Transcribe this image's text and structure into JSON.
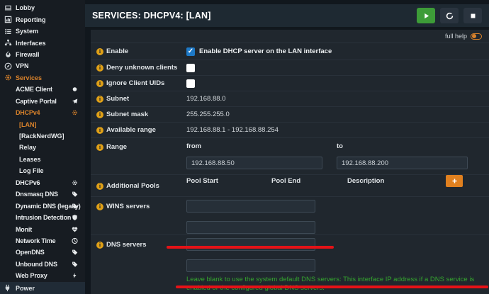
{
  "colors": {
    "accent_orange": "#d9822b",
    "note_green": "#35a62e",
    "annotation_red": "#e51217",
    "checkbox_blue": "#1d79c7",
    "play_green": "#3d9c38"
  },
  "sidebar": {
    "items": [
      {
        "label": "Lobby",
        "level": 0,
        "icon": "lobby-icon"
      },
      {
        "label": "Reporting",
        "level": 0,
        "icon": "reporting-icon"
      },
      {
        "label": "System",
        "level": 0,
        "icon": "system-icon"
      },
      {
        "label": "Interfaces",
        "level": 0,
        "icon": "interfaces-icon"
      },
      {
        "label": "Firewall",
        "level": 0,
        "icon": "firewall-icon"
      },
      {
        "label": "VPN",
        "level": 0,
        "icon": "vpn-icon"
      },
      {
        "label": "Services",
        "level": 0,
        "icon": "gear-icon",
        "active": true
      },
      {
        "label": "ACME Client",
        "level": 1,
        "right_icon": "circle-icon"
      },
      {
        "label": "Captive Portal",
        "level": 1,
        "right_icon": "paper-plane-icon"
      },
      {
        "label": "DHCPv4",
        "level": 1,
        "right_icon": "gear-icon",
        "active": true
      },
      {
        "label": "[LAN]",
        "level": 2,
        "active": true
      },
      {
        "label": "[RackNerdWG]",
        "level": 2
      },
      {
        "label": "Relay",
        "level": 2
      },
      {
        "label": "Leases",
        "level": 2
      },
      {
        "label": "Log File",
        "level": 2
      },
      {
        "label": "DHCPv6",
        "level": 1,
        "right_icon": "gear-icon"
      },
      {
        "label": "Dnsmasq DNS",
        "level": 1,
        "right_icon": "tag-icon"
      },
      {
        "label": "Dynamic DNS (legacy)",
        "level": 1,
        "right_icon": "tag-icon"
      },
      {
        "label": "Intrusion Detection",
        "level": 1,
        "right_icon": "shield-icon"
      },
      {
        "label": "Monit",
        "level": 1,
        "right_icon": "heartbeat-icon"
      },
      {
        "label": "Network Time",
        "level": 1,
        "right_icon": "clock-icon"
      },
      {
        "label": "OpenDNS",
        "level": 1,
        "right_icon": "tag-icon"
      },
      {
        "label": "Unbound DNS",
        "level": 1,
        "right_icon": "tag-icon"
      },
      {
        "label": "Web Proxy",
        "level": 1,
        "right_icon": "bolt-icon"
      }
    ],
    "power": {
      "label": "Power",
      "icon": "plug-icon"
    }
  },
  "header": {
    "title": "SERVICES: DHCPV4: [LAN]",
    "buttons": [
      {
        "name": "apply",
        "icon": "play-icon"
      },
      {
        "name": "reload",
        "icon": "reload-icon"
      },
      {
        "name": "stop",
        "icon": "stop-icon"
      }
    ]
  },
  "form": {
    "full_help_label": "full help",
    "rows": [
      {
        "label": "Enable",
        "type": "checkbox",
        "checked": true,
        "text": "Enable DHCP server on the LAN interface"
      },
      {
        "label": "Deny unknown clients",
        "type": "checkbox",
        "checked": false,
        "text": ""
      },
      {
        "label": "Ignore Client UIDs",
        "type": "checkbox",
        "checked": false,
        "text": ""
      },
      {
        "label": "Subnet",
        "type": "static",
        "value": "192.168.88.0"
      },
      {
        "label": "Subnet mask",
        "type": "static",
        "value": "255.255.255.0"
      },
      {
        "label": "Available range",
        "type": "static",
        "value": "192.168.88.1 - 192.168.88.254"
      },
      {
        "label": "Range",
        "type": "range",
        "from_label": "from",
        "to_label": "to",
        "from_value": "192.168.88.50",
        "to_value": "192.168.88.200"
      },
      {
        "label": "Additional Pools",
        "type": "pools",
        "headers": [
          "Pool Start",
          "Pool End",
          "Description"
        ]
      },
      {
        "label": "WINS servers",
        "type": "inputs2",
        "values": [
          "",
          ""
        ]
      },
      {
        "label": "DNS servers",
        "type": "inputs2",
        "values": [
          "",
          ""
        ],
        "note": "Leave blank to use the system default DNS servers: This interface IP address if a DNS service is enabled or the configured global DNS servers."
      }
    ]
  }
}
